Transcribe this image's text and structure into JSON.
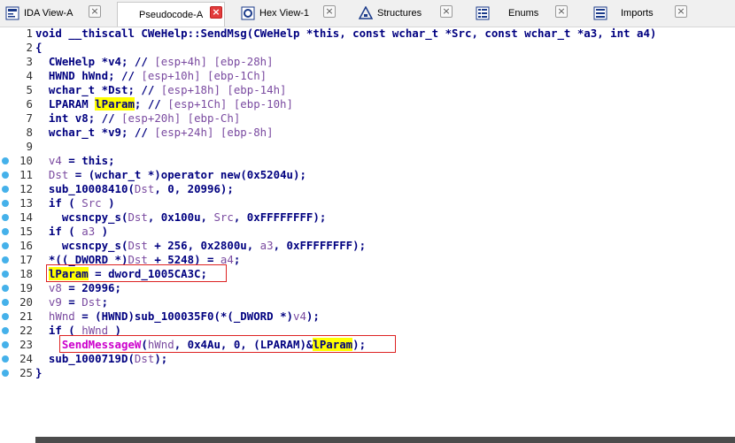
{
  "tabs": [
    {
      "label": "IDA View-A",
      "icon": "ida-view-icon",
      "active": false
    },
    {
      "label": "Pseudocode-A",
      "icon": "pseudocode-icon",
      "active": true
    },
    {
      "label": "Hex View-1",
      "icon": "hex-view-icon",
      "active": false
    },
    {
      "label": "Structures",
      "icon": "structures-icon",
      "active": false
    },
    {
      "label": "Enums",
      "icon": "enums-icon",
      "active": false
    },
    {
      "label": "Imports",
      "icon": "imports-icon",
      "active": false
    }
  ],
  "code": {
    "lines": [
      {
        "n": "1",
        "t": "void __thiscall CWeHelp::SendMsg(CWeHelp *this, const wchar_t *Src, const wchar_t *a3, int a4)"
      },
      {
        "n": "2",
        "t": "{"
      },
      {
        "n": "3",
        "t": "  CWeHelp *v4; // [esp+4h] [ebp-28h]"
      },
      {
        "n": "4",
        "t": "  HWND hWnd; // [esp+10h] [ebp-1Ch]"
      },
      {
        "n": "5",
        "t": "  wchar_t *Dst; // [esp+18h] [ebp-14h]"
      },
      {
        "n": "6",
        "t": "  LPARAM lParam; // [esp+1Ch] [ebp-10h]"
      },
      {
        "n": "7",
        "t": "  int v8; // [esp+20h] [ebp-Ch]"
      },
      {
        "n": "8",
        "t": "  wchar_t *v9; // [esp+24h] [ebp-8h]"
      },
      {
        "n": "9",
        "t": ""
      },
      {
        "n": "10",
        "t": "  v4 = this;"
      },
      {
        "n": "11",
        "t": "  Dst = (wchar_t *)operator new(0x5204u);"
      },
      {
        "n": "12",
        "t": "  sub_10008410(Dst, 0, 20996);"
      },
      {
        "n": "13",
        "t": "  if ( Src )"
      },
      {
        "n": "14",
        "t": "    wcsncpy_s(Dst, 0x100u, Src, 0xFFFFFFFF);"
      },
      {
        "n": "15",
        "t": "  if ( a3 )"
      },
      {
        "n": "16",
        "t": "    wcsncpy_s(Dst + 256, 0x2800u, a3, 0xFFFFFFFF);"
      },
      {
        "n": "17",
        "t": "  *((_DWORD *)Dst + 5248) = a4;"
      },
      {
        "n": "18",
        "t": "  lParam = dword_1005CA3C;"
      },
      {
        "n": "19",
        "t": "  v8 = 20996;"
      },
      {
        "n": "20",
        "t": "  v9 = Dst;"
      },
      {
        "n": "21",
        "t": "  hWnd = (HWND)sub_100035F0(*(_DWORD *)v4);"
      },
      {
        "n": "22",
        "t": "  if ( hWnd )"
      },
      {
        "n": "23",
        "t": "    SendMessageW(hWnd, 0x4Au, 0, (LPARAM)&lParam);"
      },
      {
        "n": "24",
        "t": "  sub_1000719D(Dst);"
      },
      {
        "n": "25",
        "t": "}"
      }
    ]
  },
  "colors": {
    "keyword": "#000080",
    "comment": "#7d7d7d",
    "local_var": "#7a4aa0",
    "api_call": "#cc00cc",
    "highlight": "#ffff00",
    "annotation_box": "#dd2222",
    "breakpoint_dot": "#45b1ea"
  }
}
